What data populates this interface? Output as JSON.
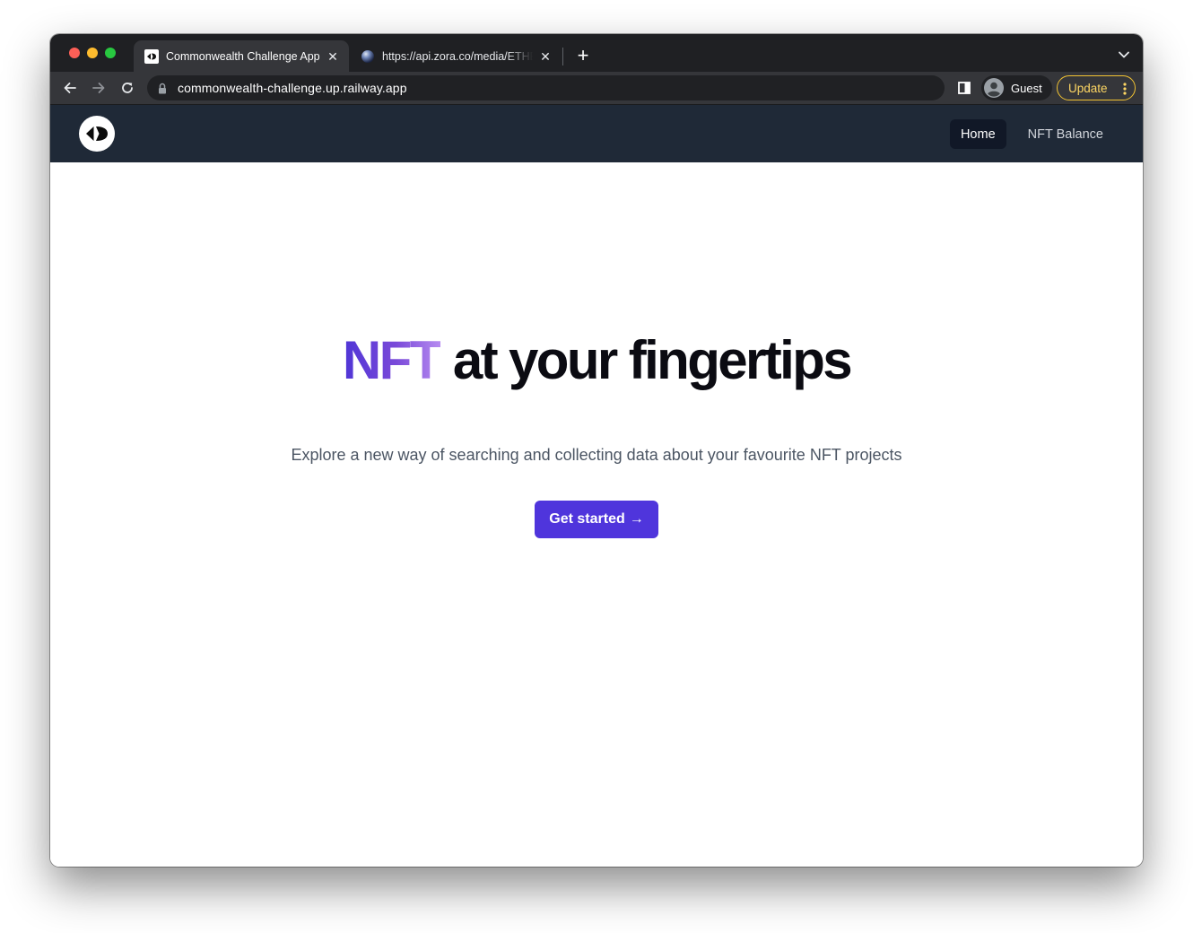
{
  "browser": {
    "tabs": [
      {
        "title": "Commonwealth Challenge App",
        "active": true,
        "favicon": "site-logo-icon"
      },
      {
        "title": "https://api.zora.co/media/ETHEREUM",
        "active": false,
        "favicon": "globe-icon"
      }
    ],
    "url": "commonwealth-challenge.up.railway.app",
    "profile_label": "Guest",
    "update_label": "Update"
  },
  "site": {
    "nav": {
      "links": [
        {
          "label": "Home",
          "current": true
        },
        {
          "label": "NFT Balance",
          "current": false
        }
      ]
    },
    "hero": {
      "title_accent": "NFT",
      "title_rest": " at your fingertips",
      "subtitle": "Explore a new way of searching and collecting data about your favourite NFT projects",
      "cta_label": "Get started",
      "cta_icon": "→"
    }
  },
  "colors": {
    "nav_background": "#1f2937",
    "cta_background": "#4f35dc",
    "accent_gradient_start": "#4f35d6",
    "accent_gradient_end": "#b68bf0",
    "update_accent": "#fdd663"
  }
}
